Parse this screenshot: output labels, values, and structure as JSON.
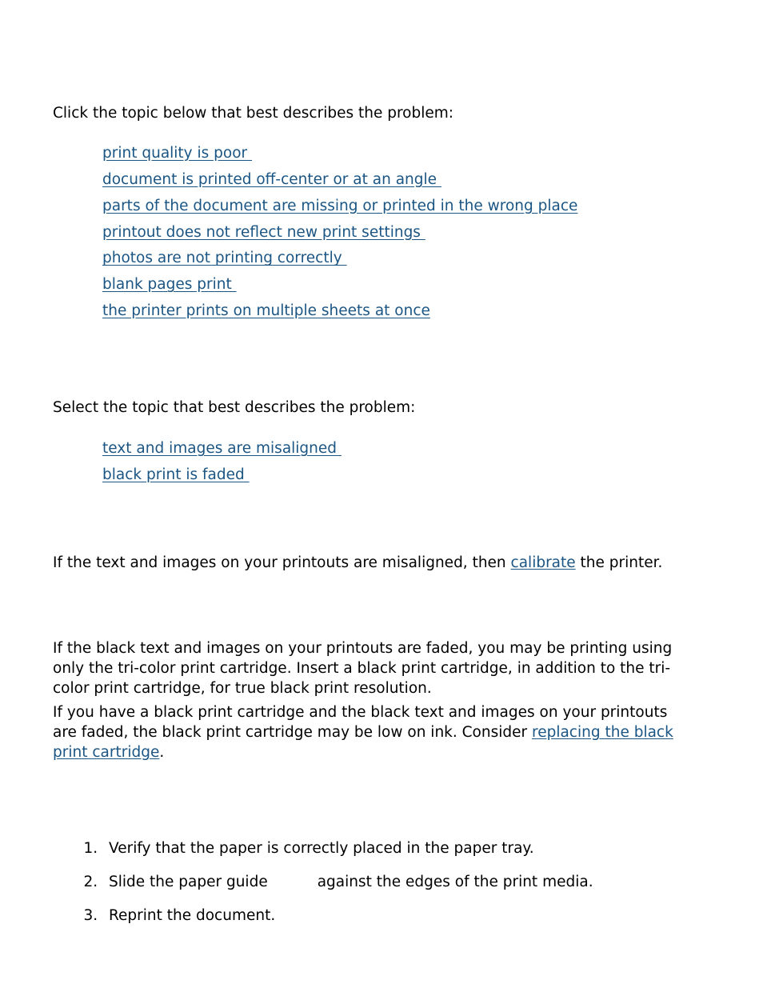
{
  "document": {
    "background_color": "#ffffff",
    "text_color": "#000000",
    "link_color": "#1a5584"
  },
  "section_problem_list": {
    "intro": "Click the topic below that best describes the problem:",
    "links": [
      {
        "label": "print quality is poor",
        "trailing_space": true
      },
      {
        "label": "document is printed off-center or at an angle",
        "trailing_space": true
      },
      {
        "label": "parts of the document are missing or printed in the wrong place",
        "trailing_space": false
      },
      {
        "label": "printout does not reflect new print settings",
        "trailing_space": true
      },
      {
        "label": "photos are not printing correctly",
        "trailing_space": true
      },
      {
        "label": "blank pages print",
        "trailing_space": true
      },
      {
        "label": "the printer prints on multiple sheets at once",
        "trailing_space": false
      }
    ]
  },
  "section_select_topic": {
    "intro": "Select the topic that best describes the problem:",
    "links": [
      {
        "label": "text and images are misaligned",
        "trailing_space": true
      },
      {
        "label": "black print is faded",
        "trailing_space": true
      }
    ]
  },
  "section_calibrate": {
    "before": "If the text and images on your printouts are misaligned, then ",
    "link": "calibrate",
    "after": " the printer."
  },
  "section_faded_black": {
    "paragraph_1": "If the black text and images on your printouts are faded, you may be printing using only the tri-color print cartridge. Insert a black print cartridge, in addition to the tri-color print cartridge, for true black print resolution.",
    "paragraph_2_before": "If you have a black print cartridge and the black text and images on your printouts are faded, the black print cartridge may be low on ink. Consider ",
    "paragraph_2_link": "replacing the black print cartridge",
    "paragraph_2_after": "."
  },
  "section_steps": {
    "items": [
      {
        "text": "Verify that the paper is correctly placed in the paper tray.",
        "has_image_gap": false,
        "text_after_gap": ""
      },
      {
        "text": "Slide the paper guide",
        "has_image_gap": true,
        "text_after_gap": "against the edges of the print media."
      },
      {
        "text": "Reprint the document.",
        "has_image_gap": false,
        "text_after_gap": ""
      }
    ]
  }
}
